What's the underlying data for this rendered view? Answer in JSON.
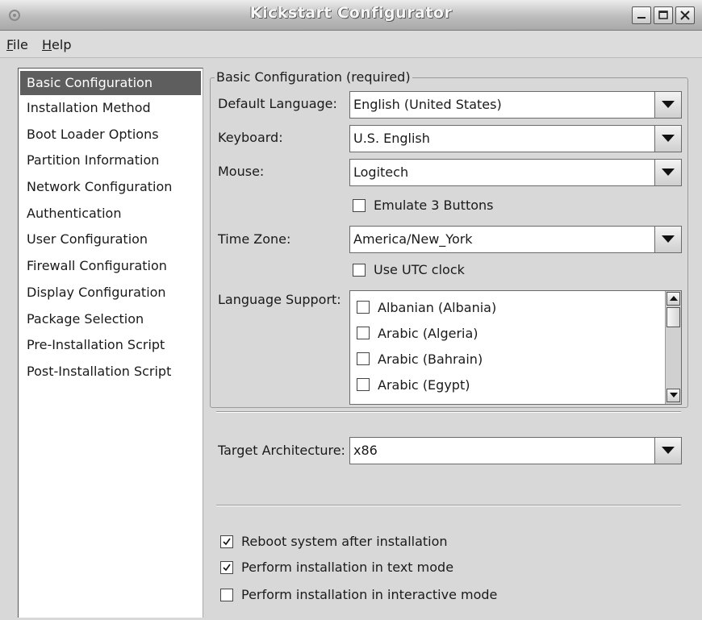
{
  "window": {
    "title": "Kickstart Configurator"
  },
  "menu": {
    "items": [
      {
        "label": "File",
        "mnemonic": "F",
        "rest": "ile"
      },
      {
        "label": "Help",
        "mnemonic": "H",
        "rest": "elp"
      }
    ]
  },
  "sidebar": {
    "items": [
      "Basic Configuration",
      "Installation Method",
      "Boot Loader Options",
      "Partition Information",
      "Network Configuration",
      "Authentication",
      "User Configuration",
      "Firewall Configuration",
      "Display Configuration",
      "Package Selection",
      "Pre-Installation Script",
      "Post-Installation Script"
    ],
    "selected": "Basic Configuration"
  },
  "basic": {
    "frame_title": "Basic Configuration (required)",
    "default_language": {
      "label": "Default Language:",
      "value": "English (United States)"
    },
    "keyboard": {
      "label": "Keyboard:",
      "value": "U.S. English"
    },
    "mouse": {
      "label": "Mouse:",
      "value": "Logitech"
    },
    "emulate_buttons": {
      "label": "Emulate 3 Buttons",
      "checked": false
    },
    "time_zone": {
      "label": "Time Zone:",
      "value": "America/New_York"
    },
    "utc_clock": {
      "label": "Use UTC clock",
      "checked": false
    },
    "language_support": {
      "label": "Language Support:",
      "options": [
        {
          "label": "Albanian (Albania)",
          "checked": false
        },
        {
          "label": "Arabic (Algeria)",
          "checked": false
        },
        {
          "label": "Arabic (Bahrain)",
          "checked": false
        },
        {
          "label": "Arabic (Egypt)",
          "checked": false
        }
      ]
    },
    "target_architecture": {
      "label": "Target Architecture:",
      "value": "x86"
    },
    "reboot": {
      "label": "Reboot system after installation",
      "checked": true
    },
    "text_mode": {
      "label": "Perform installation in text mode",
      "checked": true
    },
    "interactive_mode": {
      "label": "Perform installation in interactive mode",
      "checked": false
    }
  },
  "icons": {
    "app": "kickstart-app-icon",
    "minimize": "minimize-icon",
    "maximize": "maximize-icon",
    "close": "close-icon",
    "dropdown": "dropdown-arrow-icon",
    "check": "checkmark-icon"
  }
}
